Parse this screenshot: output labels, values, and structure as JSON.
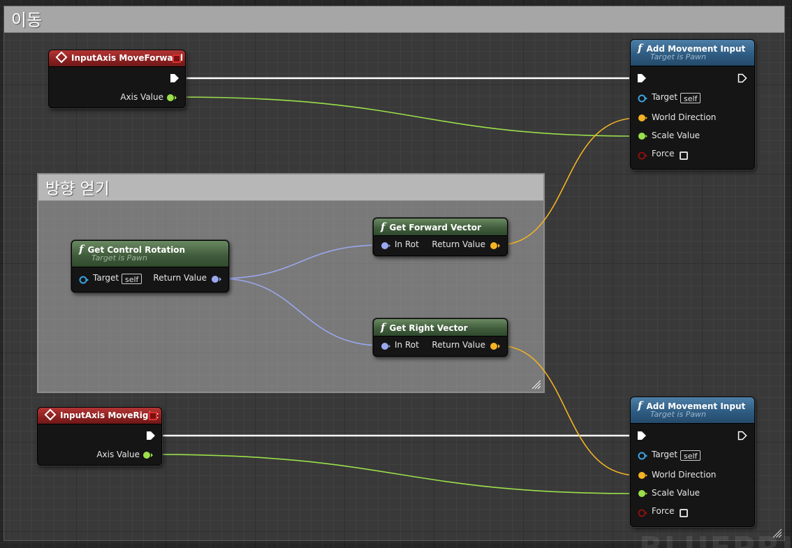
{
  "comments": {
    "outer": {
      "title": "이동"
    },
    "inner": {
      "title": "방향 얻기"
    }
  },
  "nodes": {
    "move_forward": {
      "title": "InputAxis MoveForward",
      "axis_label": "Axis Value"
    },
    "move_right": {
      "title": "InputAxis MoveRight",
      "axis_label": "Axis Value"
    },
    "add_movement_1": {
      "title": "Add Movement Input",
      "subtitle": "Target is Pawn",
      "target_label": "Target",
      "target_default": "self",
      "world_direction_label": "World Direction",
      "scale_value_label": "Scale Value",
      "force_label": "Force"
    },
    "add_movement_2": {
      "title": "Add Movement Input",
      "subtitle": "Target is Pawn",
      "target_label": "Target",
      "target_default": "self",
      "world_direction_label": "World Direction",
      "scale_value_label": "Scale Value",
      "force_label": "Force"
    },
    "get_control_rotation": {
      "title": "Get Control Rotation",
      "subtitle": "Target is Pawn",
      "target_label": "Target",
      "target_default": "self",
      "return_label": "Return Value"
    },
    "get_forward_vector": {
      "title": "Get Forward Vector",
      "in_label": "In Rot",
      "return_label": "Return Value"
    },
    "get_right_vector": {
      "title": "Get Right Vector",
      "in_label": "In Rot",
      "return_label": "Return Value"
    }
  },
  "icons": {
    "function": "f",
    "event": "diamond-icon",
    "exec": "exec-pin-icon"
  },
  "colors": {
    "exec_wire": "#ffffff",
    "float_wire": "#9ae04a",
    "vector_wire": "#f4b324",
    "rotator_wire": "#9aa8f0",
    "object_pin": "#3aa3e0",
    "bool_pin": "#8b1010",
    "event_header": "#a02828",
    "call_header": "#2f5c82",
    "pure_header": "#415d3d"
  },
  "watermark": "BLUEPRI"
}
